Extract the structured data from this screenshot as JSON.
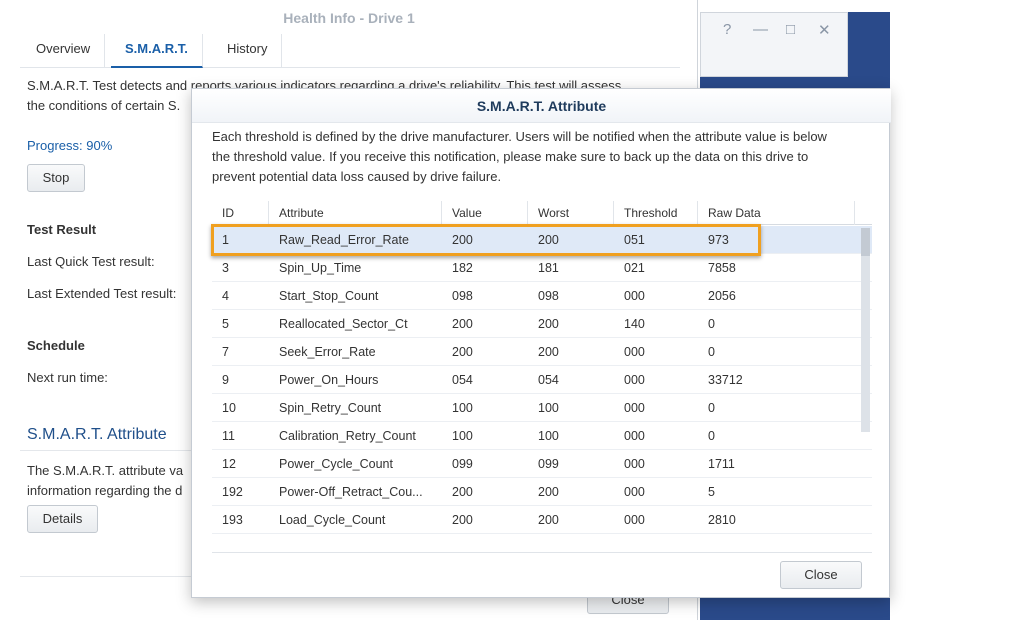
{
  "health_window": {
    "title": "Health Info - Drive 1",
    "tabs": [
      {
        "label": "Overview"
      },
      {
        "label": "S.M.A.R.T."
      },
      {
        "label": "History"
      }
    ],
    "intro_line1": "S.M.A.R.T. Test detects and reports various indicators regarding a drive's reliability. This test will assess",
    "intro_line2": "the conditions of certain S.",
    "progress": "Progress: 90%",
    "stop_label": "Stop",
    "test_result_heading": "Test Result",
    "last_quick": "Last Quick Test result:",
    "last_extended": "Last Extended Test result:",
    "schedule_heading": "Schedule",
    "next_run": "Next run time:",
    "attr_section_title": "S.M.A.R.T. Attribute",
    "attr_desc_line1": "The S.M.A.R.T. attribute va",
    "attr_desc_line2": "information regarding the d",
    "details_label": "Details",
    "close_label": "Close"
  },
  "background_window": {
    "controls": [
      "?",
      "—",
      "□",
      "✕"
    ]
  },
  "dialog": {
    "title": "S.M.A.R.T. Attribute",
    "desc_line1": "Each threshold is defined by the drive manufacturer. Users will be notified when the attribute value is below",
    "desc_line2": "the threshold value. If you receive this notification, please make sure to back up the data on this drive to",
    "desc_line3": "prevent potential data loss caused by drive failure.",
    "columns": [
      "ID",
      "Attribute",
      "Value",
      "Worst",
      "Threshold",
      "Raw Data"
    ],
    "rows": [
      [
        "1",
        "Raw_Read_Error_Rate",
        "200",
        "200",
        "051",
        "973"
      ],
      [
        "3",
        "Spin_Up_Time",
        "182",
        "181",
        "021",
        "7858"
      ],
      [
        "4",
        "Start_Stop_Count",
        "098",
        "098",
        "000",
        "2056"
      ],
      [
        "5",
        "Reallocated_Sector_Ct",
        "200",
        "200",
        "140",
        "0"
      ],
      [
        "7",
        "Seek_Error_Rate",
        "200",
        "200",
        "000",
        "0"
      ],
      [
        "9",
        "Power_On_Hours",
        "054",
        "054",
        "000",
        "33712"
      ],
      [
        "10",
        "Spin_Retry_Count",
        "100",
        "100",
        "000",
        "0"
      ],
      [
        "11",
        "Calibration_Retry_Count",
        "100",
        "100",
        "000",
        "0"
      ],
      [
        "12",
        "Power_Cycle_Count",
        "099",
        "099",
        "000",
        "1711"
      ],
      [
        "192",
        "Power-Off_Retract_Cou...",
        "200",
        "200",
        "000",
        "5"
      ],
      [
        "193",
        "Load_Cycle_Count",
        "200",
        "200",
        "000",
        "2810"
      ]
    ],
    "close_label": "Close"
  },
  "colors": {
    "accent": "#1a5fa8",
    "highlight": "#f0a020",
    "selected_row": "#dfe9f7"
  }
}
